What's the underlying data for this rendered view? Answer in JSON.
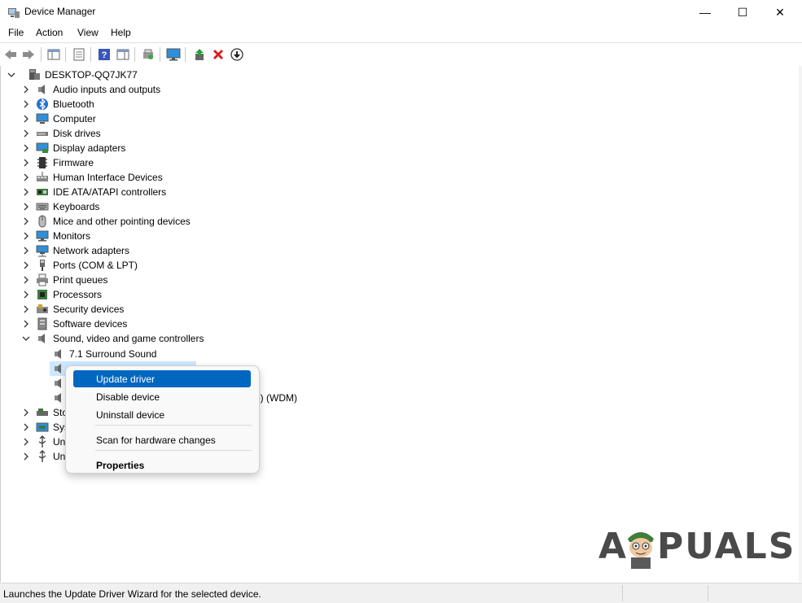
{
  "window": {
    "title": "Device Manager",
    "minimize": "—",
    "maximize": "☐",
    "close": "✕"
  },
  "menu": [
    "File",
    "Action",
    "View",
    "Help"
  ],
  "tree": {
    "root": "DESKTOP-QQ7JK77",
    "categories": [
      "Audio inputs and outputs",
      "Bluetooth",
      "Computer",
      "Disk drives",
      "Display adapters",
      "Firmware",
      "Human Interface Devices",
      "IDE ATA/ATAPI controllers",
      "Keyboards",
      "Mice and other pointing devices",
      "Monitors",
      "Network adapters",
      "Ports (COM & LPT)",
      "Print queues",
      "Processors",
      "Security devices",
      "Software devices",
      "Sound, video and game controllers"
    ],
    "sound_children": [
      "7.1 Surround Sound",
      "",
      "",
      "e) (WDM)"
    ],
    "trailing_partial": [
      "Sto",
      "Sys",
      "Un",
      "Un"
    ]
  },
  "context_menu": {
    "update": "Update driver",
    "disable": "Disable device",
    "uninstall": "Uninstall device",
    "scan": "Scan for hardware changes",
    "properties": "Properties"
  },
  "status": {
    "text": "Launches the Update Driver Wizard for the selected device."
  },
  "watermark": {
    "left": "A",
    "right": "PUALS"
  },
  "colors": {
    "selection": "#cce8ff",
    "menu_highlight": "#0067c0",
    "uninstall_x": "#d92020"
  }
}
